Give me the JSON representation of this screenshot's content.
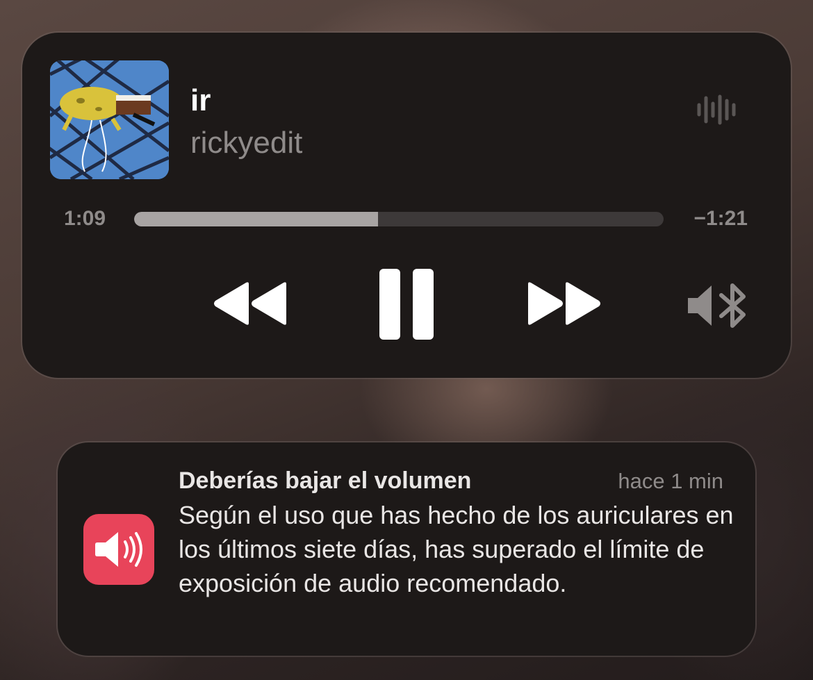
{
  "now_playing": {
    "track_title": "ir",
    "artist": "rickyedit",
    "elapsed": "1:09",
    "remaining": "−1:21",
    "progress": 0.46,
    "artwork_icon": "album-artwork",
    "controls": {
      "rewind_icon": "rewind-icon",
      "pause_icon": "pause-icon",
      "forward_icon": "fast-forward-icon",
      "output_icon": "speaker-bluetooth-icon",
      "waveform_icon": "audio-waveform-icon"
    }
  },
  "notification": {
    "title": "Deberías bajar el volumen",
    "time": "hace 1 min",
    "body": "Según el uso que has hecho de los auriculares en los últimos siete días, has superado el límite de exposición de audio recomendado.",
    "icon": "speaker-volume-icon",
    "icon_color": "#e8445a"
  },
  "colors": {
    "card_background": "#1d1918",
    "primary_text": "#ffffff",
    "secondary_text": "#8f8b8a"
  }
}
